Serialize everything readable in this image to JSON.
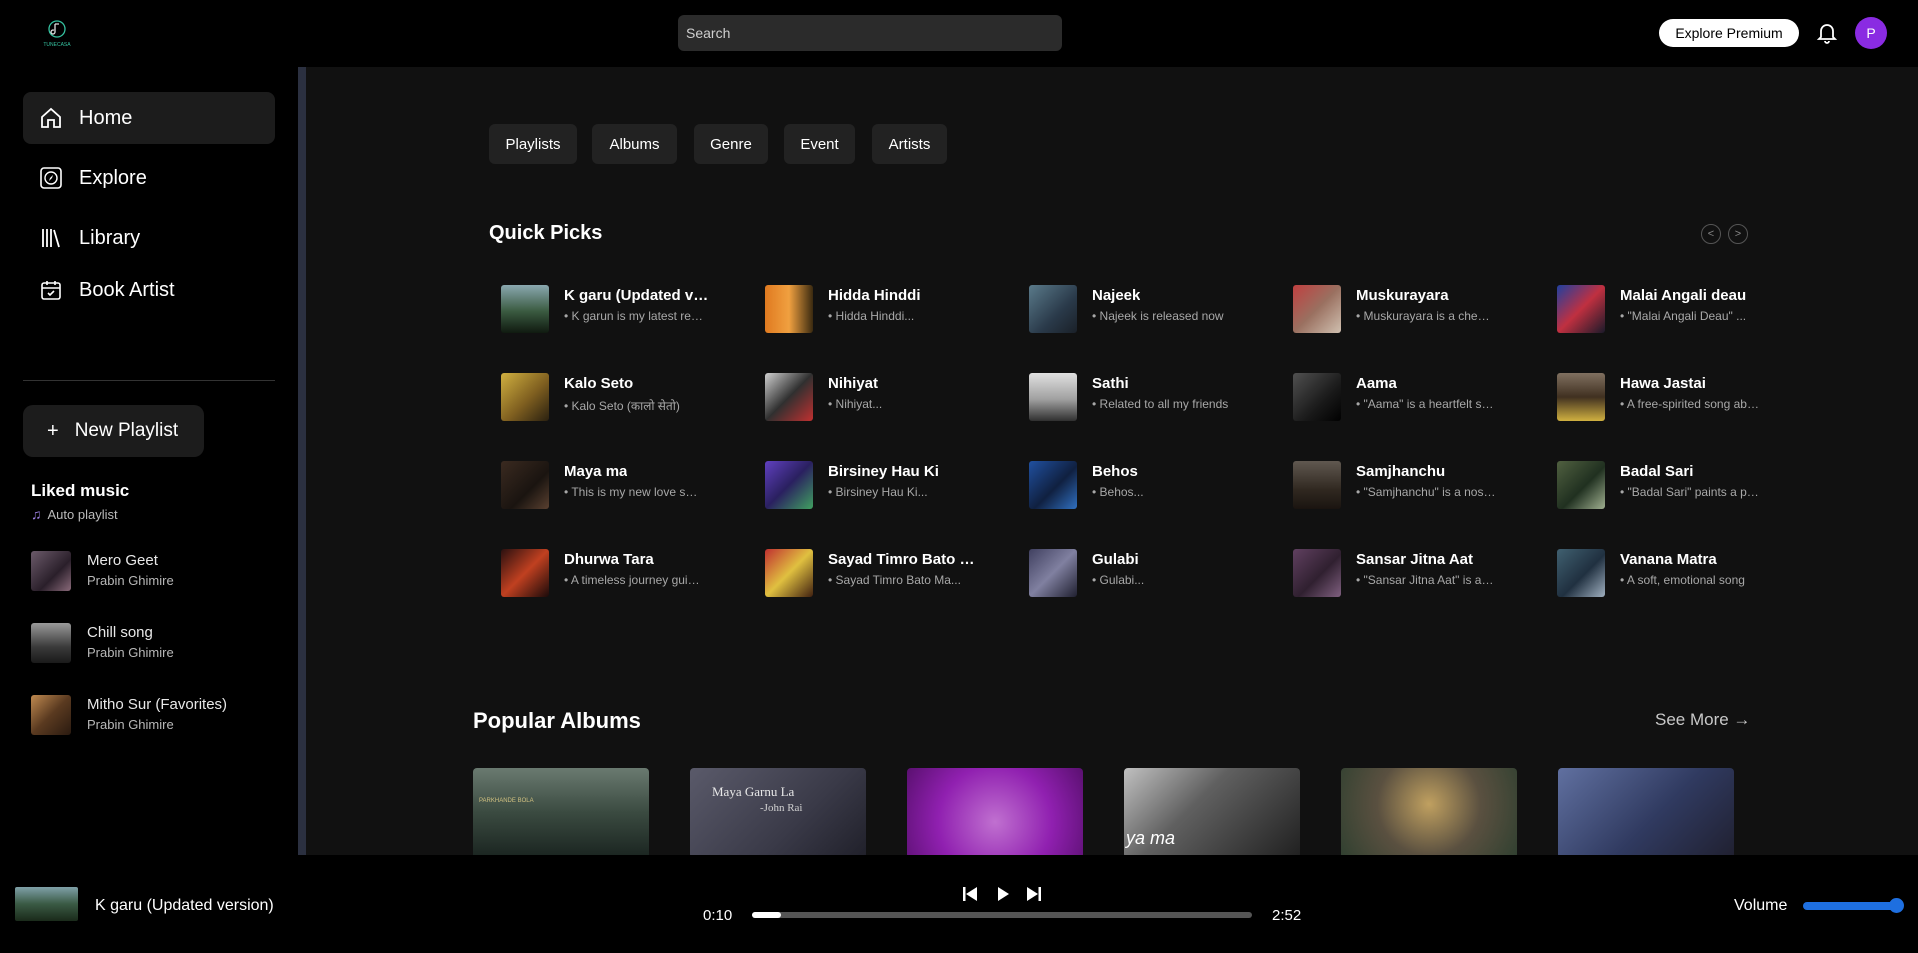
{
  "header": {
    "logo_text": "TUNECASA",
    "search_placeholder": "Search",
    "premium_label": "Explore Premium",
    "avatar_initial": "P"
  },
  "sidebar": {
    "nav": [
      {
        "label": "Home",
        "icon": "home-icon",
        "active": true
      },
      {
        "label": "Explore",
        "icon": "compass-icon"
      },
      {
        "label": "Library",
        "icon": "library-icon"
      },
      {
        "label": "Book Artist",
        "icon": "calendar-icon"
      }
    ],
    "new_playlist": "New Playlist",
    "liked_title": "Liked music",
    "liked_sub": "Auto playlist",
    "library": [
      {
        "title": "Mero Geet",
        "artist": "Prabin Ghimire"
      },
      {
        "title": "Chill song",
        "artist": "Prabin Ghimire"
      },
      {
        "title": "Mitho Sur (Favorites)",
        "artist": "Prabin Ghimire"
      }
    ]
  },
  "main": {
    "chips": [
      "Playlists",
      "Albums",
      "Genre",
      "Event",
      "Artists"
    ],
    "quick_picks_title": "Quick Picks",
    "prev_arrow": "<",
    "next_arrow": ">",
    "quick_picks": [
      [
        {
          "name": "K garu (Updated version)",
          "desc": "• K garun is my latest release"
        },
        {
          "name": "Hidda Hinddi",
          "desc": "• Hidda Hinddi..."
        },
        {
          "name": "Najeek",
          "desc": "• Najeek is released now"
        },
        {
          "name": "Muskurayara",
          "desc": "• Muskurayara is a cheerful song"
        },
        {
          "name": "Malai Angali deau",
          "desc": "• \"Malai Angali Deau\" ..."
        }
      ],
      [
        {
          "name": "Kalo Seto",
          "desc": "• Kalo Seto (कालो सेतो)"
        },
        {
          "name": "Nihiyat",
          "desc": "• Nihiyat..."
        },
        {
          "name": "Sathi",
          "desc": "• Related to all my friends"
        },
        {
          "name": "Aama",
          "desc": "• \"Aama\" is a heartfelt song"
        },
        {
          "name": "Hawa Jastai",
          "desc": "• A free-spirited song about"
        }
      ],
      [
        {
          "name": "Maya ma",
          "desc": "• This is my new love song"
        },
        {
          "name": "Birsiney Hau Ki",
          "desc": "• Birsiney Hau Ki..."
        },
        {
          "name": "Behos",
          "desc": "• Behos..."
        },
        {
          "name": "Samjhanchu",
          "desc": "• \"Samjhanchu\" is a nostalgic"
        },
        {
          "name": "Badal Sari",
          "desc": "• \"Badal Sari\" paints a picture"
        }
      ],
      [
        {
          "name": "Dhurwa Tara",
          "desc": "• A timeless journey guided"
        },
        {
          "name": "Sayad Timro Bato Ma",
          "desc": "• Sayad Timro Bato Ma..."
        },
        {
          "name": "Gulabi",
          "desc": "• Gulabi..."
        },
        {
          "name": "Sansar Jitna Aat",
          "desc": "• \"Sansar Jitna Aat\" is a song"
        },
        {
          "name": "Vanana Matra",
          "desc": "• A soft, emotional song"
        }
      ]
    ],
    "popular_albums_title": "Popular Albums",
    "see_more": "See More →",
    "albums": [
      {
        "caption": "PARKHANDE BOLA"
      },
      {
        "caption": "Maya Garnu La",
        "sub": "-John Rai"
      },
      {
        "caption": ""
      },
      {
        "caption": "ya ma"
      },
      {
        "caption": ""
      },
      {
        "caption": ""
      }
    ]
  },
  "player": {
    "title": "K garu (Updated version)",
    "current": "0:10",
    "duration": "2:52",
    "progress_fraction": 0.058,
    "volume_label": "Volume",
    "volume_fraction": 0.93
  },
  "colors": {
    "accent": "#8a2be2",
    "volume": "#1e6fe0",
    "sidebar_edge": "#2b3040"
  }
}
